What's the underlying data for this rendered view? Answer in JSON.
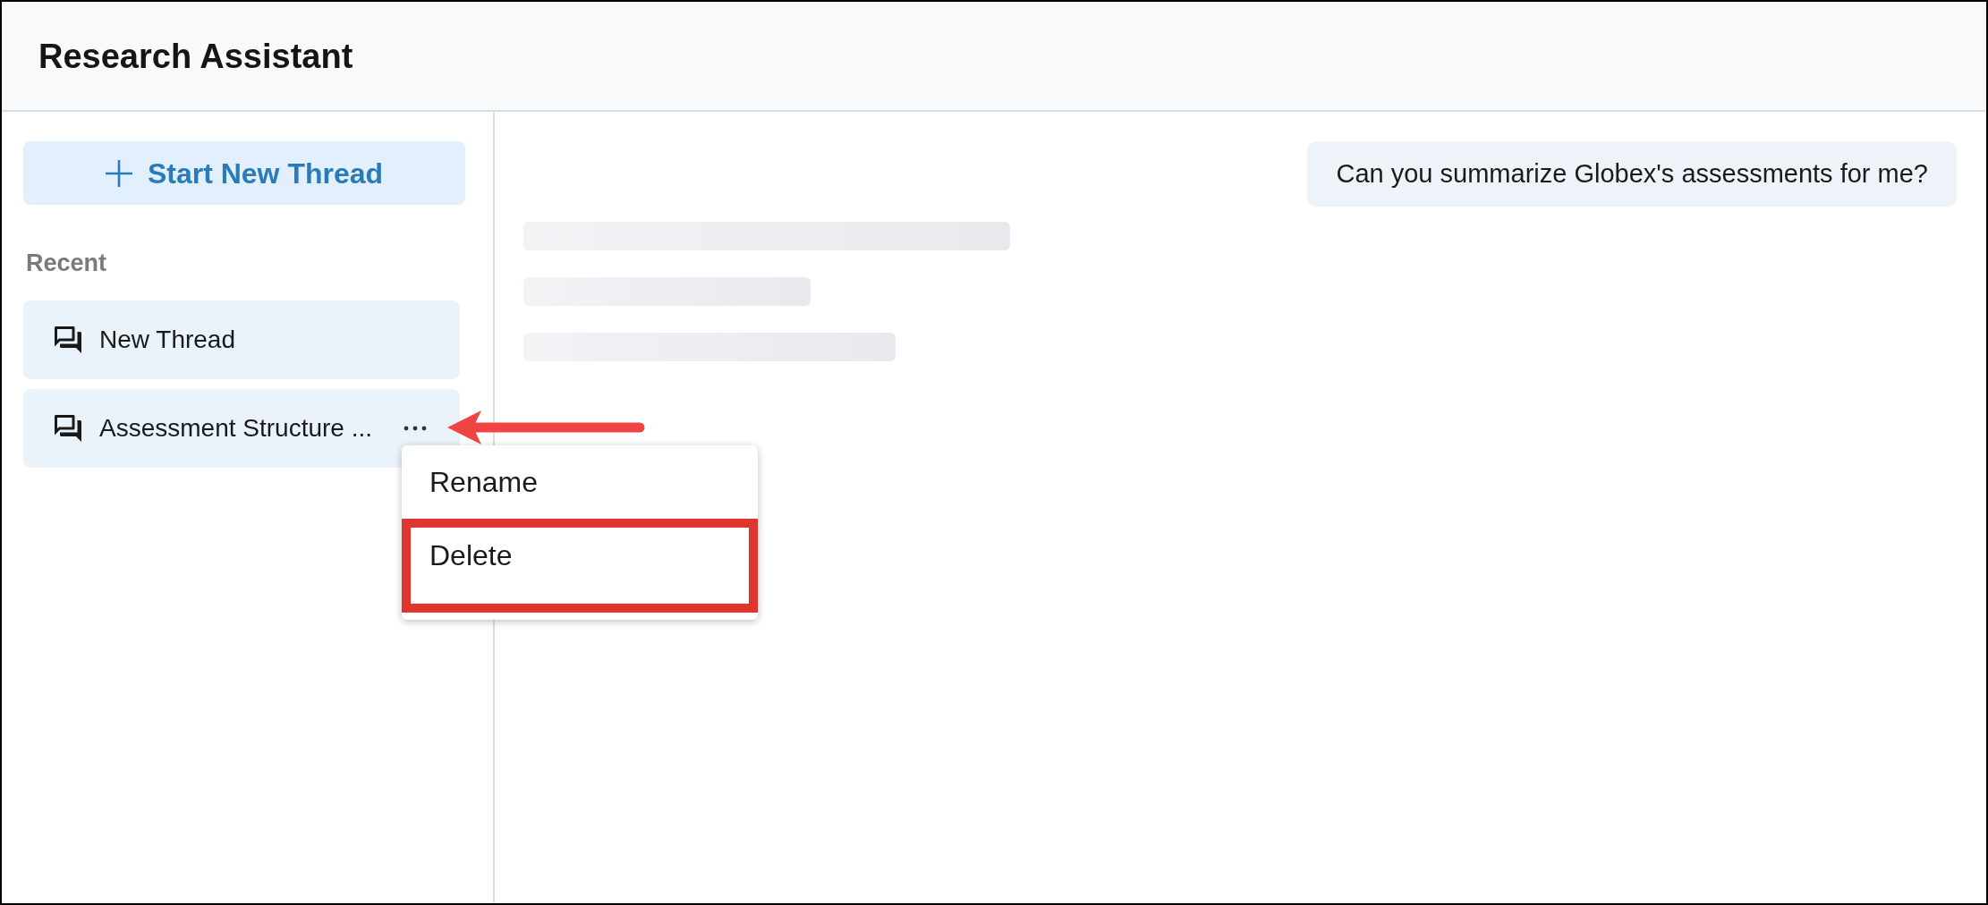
{
  "window": {
    "title": "Research Assistant"
  },
  "sidebar": {
    "new_thread_button": {
      "label": "Start New Thread"
    },
    "section_label": "Recent",
    "threads": [
      {
        "label": "New Thread",
        "menu_open": false
      },
      {
        "label": "Assessment Structure ...",
        "menu_open": true
      }
    ]
  },
  "context_menu": {
    "items": [
      {
        "label": "Rename",
        "highlighted": false
      },
      {
        "label": "Delete",
        "highlighted": true
      }
    ]
  },
  "conversation": {
    "messages": [
      {
        "kind": "user",
        "text": "Can you summarize Globex's assessments for me?"
      }
    ],
    "response": {
      "loading": true
    }
  }
}
